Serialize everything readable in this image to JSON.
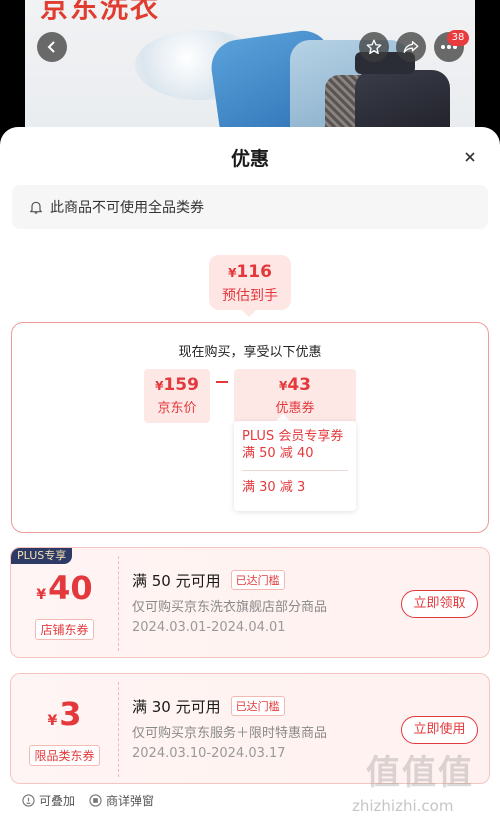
{
  "background": {
    "banner_text": "京东洗衣",
    "cart_badge": "38"
  },
  "sheet": {
    "title": "优惠",
    "notice": "此商品不可使用全品类券"
  },
  "final_price": {
    "currency": "¥",
    "amount": "116",
    "label": "预估到手"
  },
  "calculation": {
    "heading": "现在购买，享受以下优惠",
    "jd_price": {
      "currency": "¥",
      "amount": "159",
      "label": "京东价"
    },
    "discount": {
      "currency": "¥",
      "amount": "43",
      "label": "优惠券"
    },
    "details": [
      {
        "text": "PLUS 会员专享券\n满 50 减 40"
      },
      {
        "text": "满 30 减 3"
      }
    ]
  },
  "coupons": [
    {
      "badge": "PLUS专享",
      "currency": "¥",
      "amount": "40",
      "type": "店铺东券",
      "title": "满 50 元可用",
      "condition": "已达门槛",
      "description": "仅可购买京东洗衣旗舰店部分商品",
      "date_range": "2024.03.01-2024.04.01",
      "action": "立即领取"
    },
    {
      "badge": "",
      "currency": "¥",
      "amount": "3",
      "type": "限品类东券",
      "title": "满 30 元可用",
      "condition": "已达门槛",
      "description": "仅可购买京东服务＋限时特惠商品",
      "date_range": "2024.03.10-2024.03.17",
      "action": "立即使用"
    }
  ],
  "footer": {
    "stackable": "可叠加",
    "detail_popup": "商详弹窗"
  },
  "watermark": {
    "logo": "值值值",
    "url": "zhizhizhi.com"
  },
  "colors": {
    "accent": "#e4393c",
    "plus_badge": "#2e3a66"
  },
  "icons": [
    "back-icon",
    "star-icon",
    "share-icon",
    "more-icon",
    "close-icon",
    "bell-icon",
    "info-icon"
  ]
}
